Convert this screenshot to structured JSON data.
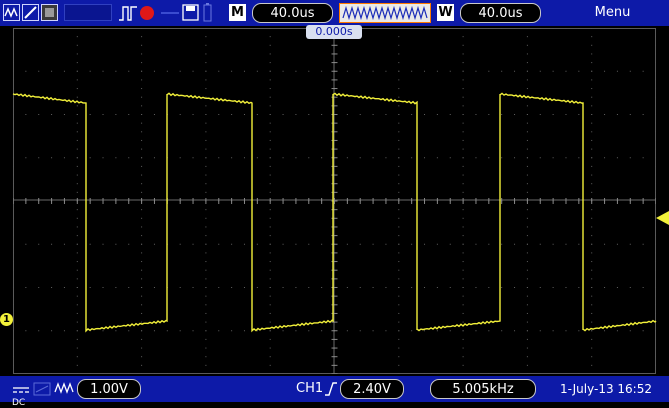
{
  "top": {
    "m_label": "M",
    "m_time": "40.0us",
    "w_label": "W",
    "w_time": "40.0us",
    "menu": "Menu",
    "trigger_position": "0.000s"
  },
  "bottom": {
    "coupling": "DC",
    "volts_div": "1.00V",
    "trig_channel": "CH1",
    "trig_level": "2.40V",
    "frequency": "5.005kHz",
    "datetime": "1-July-13 16:52"
  },
  "channel_marker": "1",
  "icons": [
    "waveform-mode-icon",
    "line-mode-icon",
    "persist-icon",
    "pulse-icon",
    "record-icon",
    "usb-icon",
    "save-icon",
    "battery-icon"
  ],
  "colors": {
    "trace": "#f2f03a",
    "bar": "#0d1aa8",
    "accent": "#ff7a00"
  }
}
